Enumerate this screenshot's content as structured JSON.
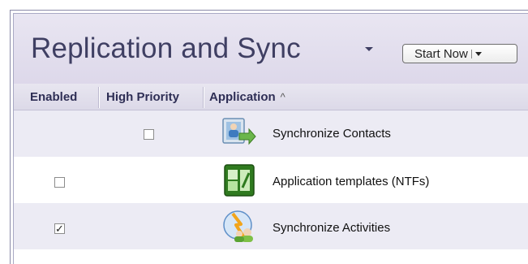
{
  "header": {
    "title": "Replication and Sync",
    "start_button_label": "Start Now"
  },
  "columns": {
    "enabled": "Enabled",
    "high_priority": "High Priority",
    "application": "Application",
    "sort_indicator": "^"
  },
  "rows": [
    {
      "label": "Synchronize Contacts",
      "enabled_checkbox_visible": false,
      "enabled": false,
      "high_priority_checkbox_visible": true,
      "high_priority": false,
      "icon": "contacts-sync-icon",
      "check": ""
    },
    {
      "label": "Application templates (NTFs)",
      "enabled_checkbox_visible": true,
      "enabled": false,
      "high_priority_checkbox_visible": false,
      "high_priority": false,
      "icon": "templates-icon",
      "check": ""
    },
    {
      "label": "Synchronize Activities",
      "enabled_checkbox_visible": true,
      "enabled": true,
      "high_priority_checkbox_visible": false,
      "high_priority": false,
      "icon": "activities-sync-icon",
      "check": "✓"
    }
  ],
  "colors": {
    "header_bg": "#e4e0ef",
    "title": "#3f3f63",
    "alt_row": "#ecebf4"
  }
}
